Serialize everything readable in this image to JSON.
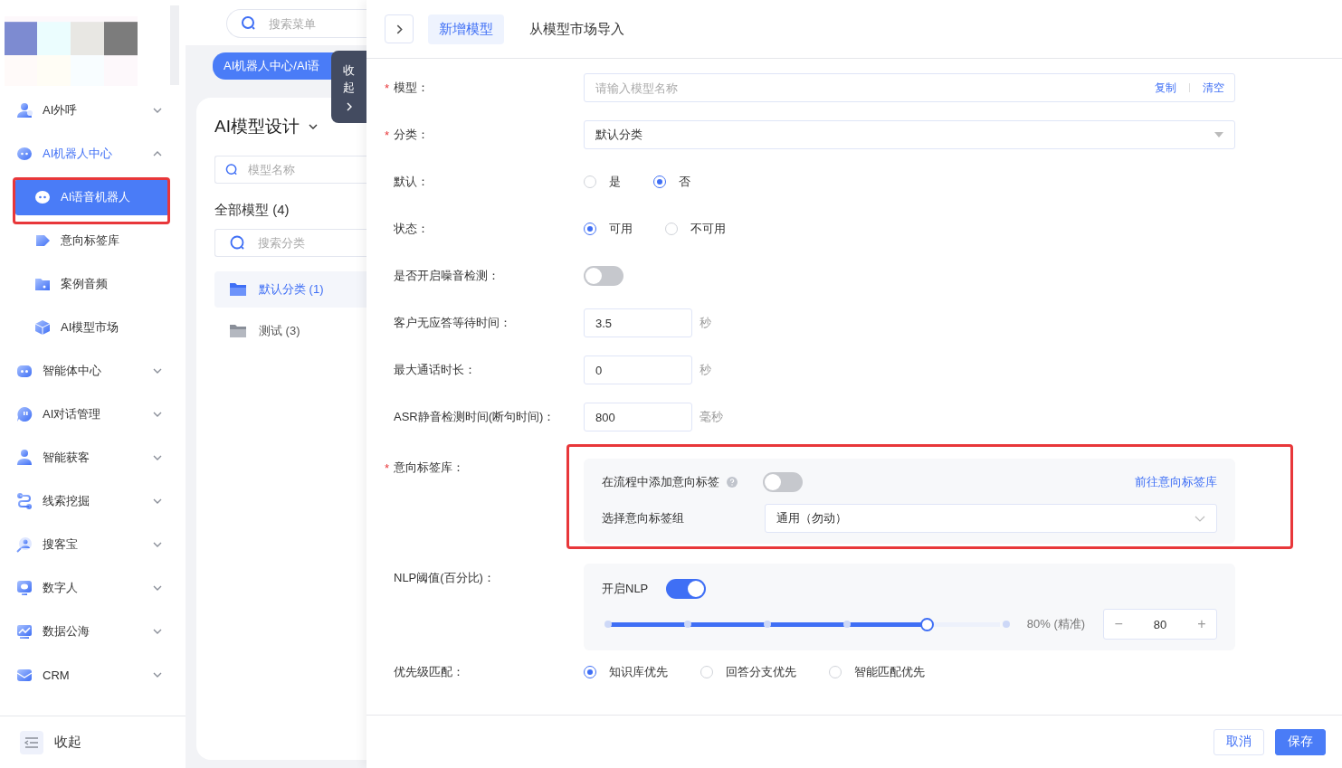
{
  "sidebar": {
    "items": [
      {
        "label": "AI外呼",
        "expanded": false
      },
      {
        "label": "AI机器人中心",
        "expanded": true,
        "children": [
          {
            "label": "AI语音机器人",
            "selected": true,
            "highlighted": true
          },
          {
            "label": "意向标签库",
            "selected": false,
            "highlighted": false
          },
          {
            "label": "案例音频",
            "selected": false,
            "highlighted": false
          },
          {
            "label": "AI模型市场",
            "selected": false,
            "highlighted": false
          }
        ]
      },
      {
        "label": "智能体中心",
        "expanded": false
      },
      {
        "label": "AI对话管理",
        "expanded": false
      },
      {
        "label": "智能获客",
        "expanded": false
      },
      {
        "label": "线索挖掘",
        "expanded": false
      },
      {
        "label": "搜客宝",
        "expanded": false
      },
      {
        "label": "数字人",
        "expanded": false
      },
      {
        "label": "数据公海",
        "expanded": false
      },
      {
        "label": "CRM",
        "expanded": false
      }
    ],
    "collapse_label": "收起"
  },
  "menu_search": {
    "placeholder": "搜索菜单"
  },
  "breadcrumb": "AI机器人中心/AI语",
  "drawer_handle": {
    "label": "收起"
  },
  "model_panel": {
    "title": "AI模型设计",
    "search": {
      "placeholder": "模型名称"
    },
    "all_models": "全部模型 (4)",
    "category_search": {
      "placeholder": "搜索分类"
    },
    "categories": [
      {
        "label": "默认分类 (1)",
        "selected": true
      },
      {
        "label": "测试 (3)",
        "selected": false
      }
    ]
  },
  "drawer": {
    "tabs": [
      {
        "label": "新增模型",
        "selected": true
      },
      {
        "label": "从模型市场导入",
        "selected": false
      }
    ],
    "required_mark": "*",
    "form": [
      {
        "kind": "text",
        "label": "模型：",
        "required": true,
        "highlighted": false,
        "placeholder": "请输入模型名称",
        "actions": [
          "复制",
          "清空"
        ]
      },
      {
        "kind": "select",
        "label": "分类：",
        "required": true,
        "highlighted": false,
        "value": "默认分类"
      },
      {
        "kind": "radio",
        "label": "默认：",
        "required": false,
        "highlighted": false,
        "options": [
          {
            "label": "是",
            "selected": false
          },
          {
            "label": "否",
            "selected": true
          }
        ]
      },
      {
        "kind": "radio",
        "label": "状态：",
        "required": false,
        "highlighted": false,
        "options": [
          {
            "label": "可用",
            "selected": true
          },
          {
            "label": "不可用",
            "selected": false
          }
        ]
      },
      {
        "kind": "switch",
        "label": "是否开启噪音检测：",
        "required": false,
        "highlighted": false,
        "on": false
      },
      {
        "kind": "number",
        "label": "客户无应答等待时间：",
        "required": false,
        "highlighted": false,
        "value": "3.5",
        "unit": "秒"
      },
      {
        "kind": "number",
        "label": "最大通话时长：",
        "required": false,
        "highlighted": false,
        "value": "0",
        "unit": "秒"
      },
      {
        "kind": "number",
        "label": "ASR静音检测时间(断句时间)：",
        "required": false,
        "highlighted": false,
        "value": "800",
        "unit": "毫秒"
      },
      {
        "kind": "intent",
        "label": "意向标签库：",
        "required": true,
        "highlighted": true,
        "switch_label": "在流程中添加意向标签",
        "on": false,
        "link": "前往意向标签库",
        "group_label": "选择意向标签组",
        "group_value": "通用（勿动）"
      },
      {
        "kind": "nlp",
        "label": "NLP阈值(百分比)：",
        "required": false,
        "highlighted": false,
        "switch_label": "开启NLP",
        "on": true,
        "level": 0.8,
        "reading": "80% (精准)",
        "stepper_value": "80",
        "minus": "−",
        "plus": "+"
      },
      {
        "kind": "radio",
        "label": "优先级匹配：",
        "required": false,
        "highlighted": false,
        "options": [
          {
            "label": "知识库优先",
            "selected": true
          },
          {
            "label": "回答分支优先",
            "selected": false
          },
          {
            "label": "智能匹配优先",
            "selected": false
          }
        ]
      }
    ],
    "buttons": [
      {
        "label": "取消",
        "kind": "secondary"
      },
      {
        "label": "保存",
        "kind": "primary"
      }
    ]
  }
}
